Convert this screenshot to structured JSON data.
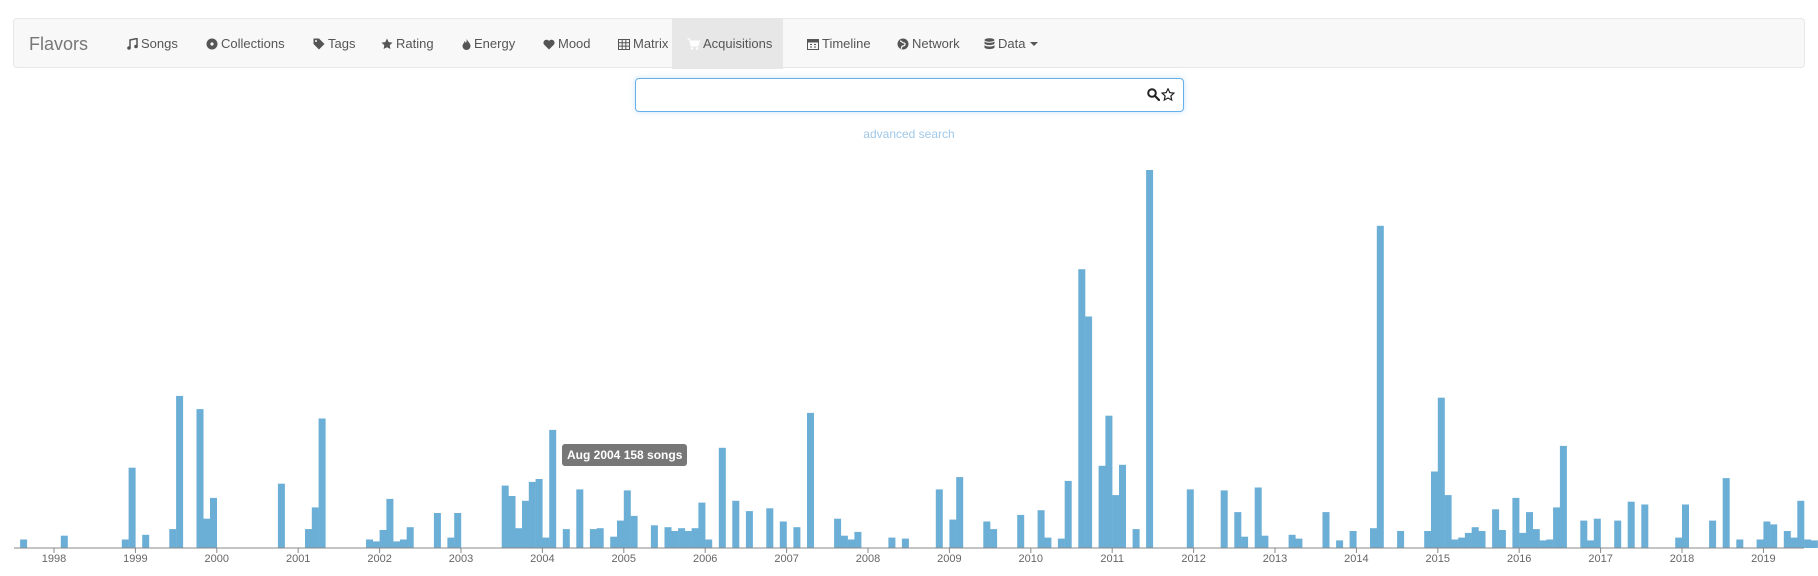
{
  "app": {
    "brand": "Flavors"
  },
  "nav": [
    {
      "label": "Songs",
      "icon": "music-icon"
    },
    {
      "label": "Collections",
      "icon": "disc-icon"
    },
    {
      "label": "Tags",
      "icon": "tag-icon"
    },
    {
      "label": "Rating",
      "icon": "star-icon"
    },
    {
      "label": "Energy",
      "icon": "fire-icon"
    },
    {
      "label": "Mood",
      "icon": "heart-icon"
    },
    {
      "label": "Matrix",
      "icon": "table-icon"
    },
    {
      "label": "Acquisitions",
      "icon": "cart-icon",
      "active": true
    },
    {
      "label": "Timeline",
      "icon": "calendar-icon"
    },
    {
      "label": "Network",
      "icon": "globe-icon"
    },
    {
      "label": "Data",
      "icon": "database-icon",
      "dropdown": true
    }
  ],
  "search": {
    "value": "",
    "placeholder": ""
  },
  "advanced_search_label": "advanced search",
  "tooltip": {
    "text": "Aug 2004 158 songs"
  },
  "colors": {
    "bar": "#6baed6",
    "active_tab": "#e7e7e7",
    "search_focus": "#66afe9"
  },
  "chart_data": {
    "type": "bar",
    "xlabel": "",
    "ylabel": "",
    "x_ticks": [
      "1998",
      "1999",
      "2000",
      "2001",
      "2002",
      "2003",
      "2004",
      "2005",
      "2006",
      "2007",
      "2008",
      "2009",
      "2010",
      "2011",
      "2012",
      "2013",
      "2014",
      "2015",
      "2016",
      "2017",
      "2018",
      "2019"
    ],
    "ylim": [
      0,
      400
    ],
    "series": [
      {
        "values": [
          {
            "date": "1997-08",
            "v": 9
          },
          {
            "date": "1998-02",
            "v": 13
          },
          {
            "date": "1998-11",
            "v": 9
          },
          {
            "date": "1998-12",
            "v": 85
          },
          {
            "date": "1999-02",
            "v": 14
          },
          {
            "date": "1999-06",
            "v": 20
          },
          {
            "date": "1999-07",
            "v": 161
          },
          {
            "date": "1999-10",
            "v": 147
          },
          {
            "date": "1999-11",
            "v": 31
          },
          {
            "date": "1999-12",
            "v": 53
          },
          {
            "date": "2000-10",
            "v": 68
          },
          {
            "date": "2001-02",
            "v": 20
          },
          {
            "date": "2001-03",
            "v": 43
          },
          {
            "date": "2001-04",
            "v": 137
          },
          {
            "date": "2001-11",
            "v": 9
          },
          {
            "date": "2001-12",
            "v": 7
          },
          {
            "date": "2002-01",
            "v": 19
          },
          {
            "date": "2002-02",
            "v": 52
          },
          {
            "date": "2002-03",
            "v": 7
          },
          {
            "date": "2002-04",
            "v": 9
          },
          {
            "date": "2002-05",
            "v": 22
          },
          {
            "date": "2002-09",
            "v": 37
          },
          {
            "date": "2002-11",
            "v": 11
          },
          {
            "date": "2002-12",
            "v": 37
          },
          {
            "date": "2003-07",
            "v": 66
          },
          {
            "date": "2003-08",
            "v": 55
          },
          {
            "date": "2003-09",
            "v": 21
          },
          {
            "date": "2003-10",
            "v": 50
          },
          {
            "date": "2003-11",
            "v": 70
          },
          {
            "date": "2003-12",
            "v": 73
          },
          {
            "date": "2004-01",
            "v": 11
          },
          {
            "date": "2004-02",
            "v": 125
          },
          {
            "date": "2004-04",
            "v": 20
          },
          {
            "date": "2004-06",
            "v": 62
          },
          {
            "date": "2004-08",
            "v": 20
          },
          {
            "date": "2004-09",
            "v": 21
          },
          {
            "date": "2004-11",
            "v": 12
          },
          {
            "date": "2004-12",
            "v": 29
          },
          {
            "date": "2005-01",
            "v": 61
          },
          {
            "date": "2005-02",
            "v": 34
          },
          {
            "date": "2005-05",
            "v": 24
          },
          {
            "date": "2005-07",
            "v": 22
          },
          {
            "date": "2005-08",
            "v": 18
          },
          {
            "date": "2005-09",
            "v": 21
          },
          {
            "date": "2005-10",
            "v": 18
          },
          {
            "date": "2005-11",
            "v": 21
          },
          {
            "date": "2005-12",
            "v": 48
          },
          {
            "date": "2006-01",
            "v": 9
          },
          {
            "date": "2006-03",
            "v": 106
          },
          {
            "date": "2006-05",
            "v": 50
          },
          {
            "date": "2006-07",
            "v": 39
          },
          {
            "date": "2006-10",
            "v": 42
          },
          {
            "date": "2006-12",
            "v": 28
          },
          {
            "date": "2007-02",
            "v": 22
          },
          {
            "date": "2007-04",
            "v": 143
          },
          {
            "date": "2007-08",
            "v": 31
          },
          {
            "date": "2007-09",
            "v": 13
          },
          {
            "date": "2007-10",
            "v": 9
          },
          {
            "date": "2007-11",
            "v": 17
          },
          {
            "date": "2008-04",
            "v": 11
          },
          {
            "date": "2008-06",
            "v": 10
          },
          {
            "date": "2008-11",
            "v": 62
          },
          {
            "date": "2009-01",
            "v": 30
          },
          {
            "date": "2009-02",
            "v": 75
          },
          {
            "date": "2009-06",
            "v": 28
          },
          {
            "date": "2009-07",
            "v": 20
          },
          {
            "date": "2009-11",
            "v": 35
          },
          {
            "date": "2010-02",
            "v": 40
          },
          {
            "date": "2010-03",
            "v": 11
          },
          {
            "date": "2010-05",
            "v": 10
          },
          {
            "date": "2010-06",
            "v": 71
          },
          {
            "date": "2010-08",
            "v": 295
          },
          {
            "date": "2010-09",
            "v": 245
          },
          {
            "date": "2010-11",
            "v": 87
          },
          {
            "date": "2010-12",
            "v": 140
          },
          {
            "date": "2011-01",
            "v": 56
          },
          {
            "date": "2011-02",
            "v": 88
          },
          {
            "date": "2011-04",
            "v": 20
          },
          {
            "date": "2011-06",
            "v": 400
          },
          {
            "date": "2011-12",
            "v": 62
          },
          {
            "date": "2012-05",
            "v": 61
          },
          {
            "date": "2012-07",
            "v": 38
          },
          {
            "date": "2012-08",
            "v": 12
          },
          {
            "date": "2012-10",
            "v": 64
          },
          {
            "date": "2012-11",
            "v": 13
          },
          {
            "date": "2013-03",
            "v": 14
          },
          {
            "date": "2013-04",
            "v": 10
          },
          {
            "date": "2013-08",
            "v": 38
          },
          {
            "date": "2013-10",
            "v": 8
          },
          {
            "date": "2013-12",
            "v": 18
          },
          {
            "date": "2014-03",
            "v": 21
          },
          {
            "date": "2014-04",
            "v": 341
          },
          {
            "date": "2014-07",
            "v": 18
          },
          {
            "date": "2014-11",
            "v": 18
          },
          {
            "date": "2014-12",
            "v": 81
          },
          {
            "date": "2015-01",
            "v": 159
          },
          {
            "date": "2015-02",
            "v": 56
          },
          {
            "date": "2015-03",
            "v": 9
          },
          {
            "date": "2015-04",
            "v": 11
          },
          {
            "date": "2015-05",
            "v": 16
          },
          {
            "date": "2015-06",
            "v": 22
          },
          {
            "date": "2015-07",
            "v": 18
          },
          {
            "date": "2015-09",
            "v": 41
          },
          {
            "date": "2015-10",
            "v": 19
          },
          {
            "date": "2015-12",
            "v": 53
          },
          {
            "date": "2016-01",
            "v": 16
          },
          {
            "date": "2016-02",
            "v": 38
          },
          {
            "date": "2016-03",
            "v": 20
          },
          {
            "date": "2016-04",
            "v": 8
          },
          {
            "date": "2016-05",
            "v": 9
          },
          {
            "date": "2016-06",
            "v": 43
          },
          {
            "date": "2016-07",
            "v": 108
          },
          {
            "date": "2016-10",
            "v": 29
          },
          {
            "date": "2016-11",
            "v": 8
          },
          {
            "date": "2016-12",
            "v": 31
          },
          {
            "date": "2017-03",
            "v": 29
          },
          {
            "date": "2017-05",
            "v": 49
          },
          {
            "date": "2017-07",
            "v": 46
          },
          {
            "date": "2017-12",
            "v": 11
          },
          {
            "date": "2018-01",
            "v": 46
          },
          {
            "date": "2018-05",
            "v": 29
          },
          {
            "date": "2018-07",
            "v": 74
          },
          {
            "date": "2018-09",
            "v": 9
          },
          {
            "date": "2018-12",
            "v": 9
          },
          {
            "date": "2019-01",
            "v": 28
          },
          {
            "date": "2019-02",
            "v": 25
          },
          {
            "date": "2019-04",
            "v": 18
          },
          {
            "date": "2019-05",
            "v": 11
          },
          {
            "date": "2019-06",
            "v": 50
          },
          {
            "date": "2019-07",
            "v": 9
          },
          {
            "date": "2019-08",
            "v": 8
          }
        ]
      }
    ],
    "grid": false,
    "legend": "none"
  }
}
